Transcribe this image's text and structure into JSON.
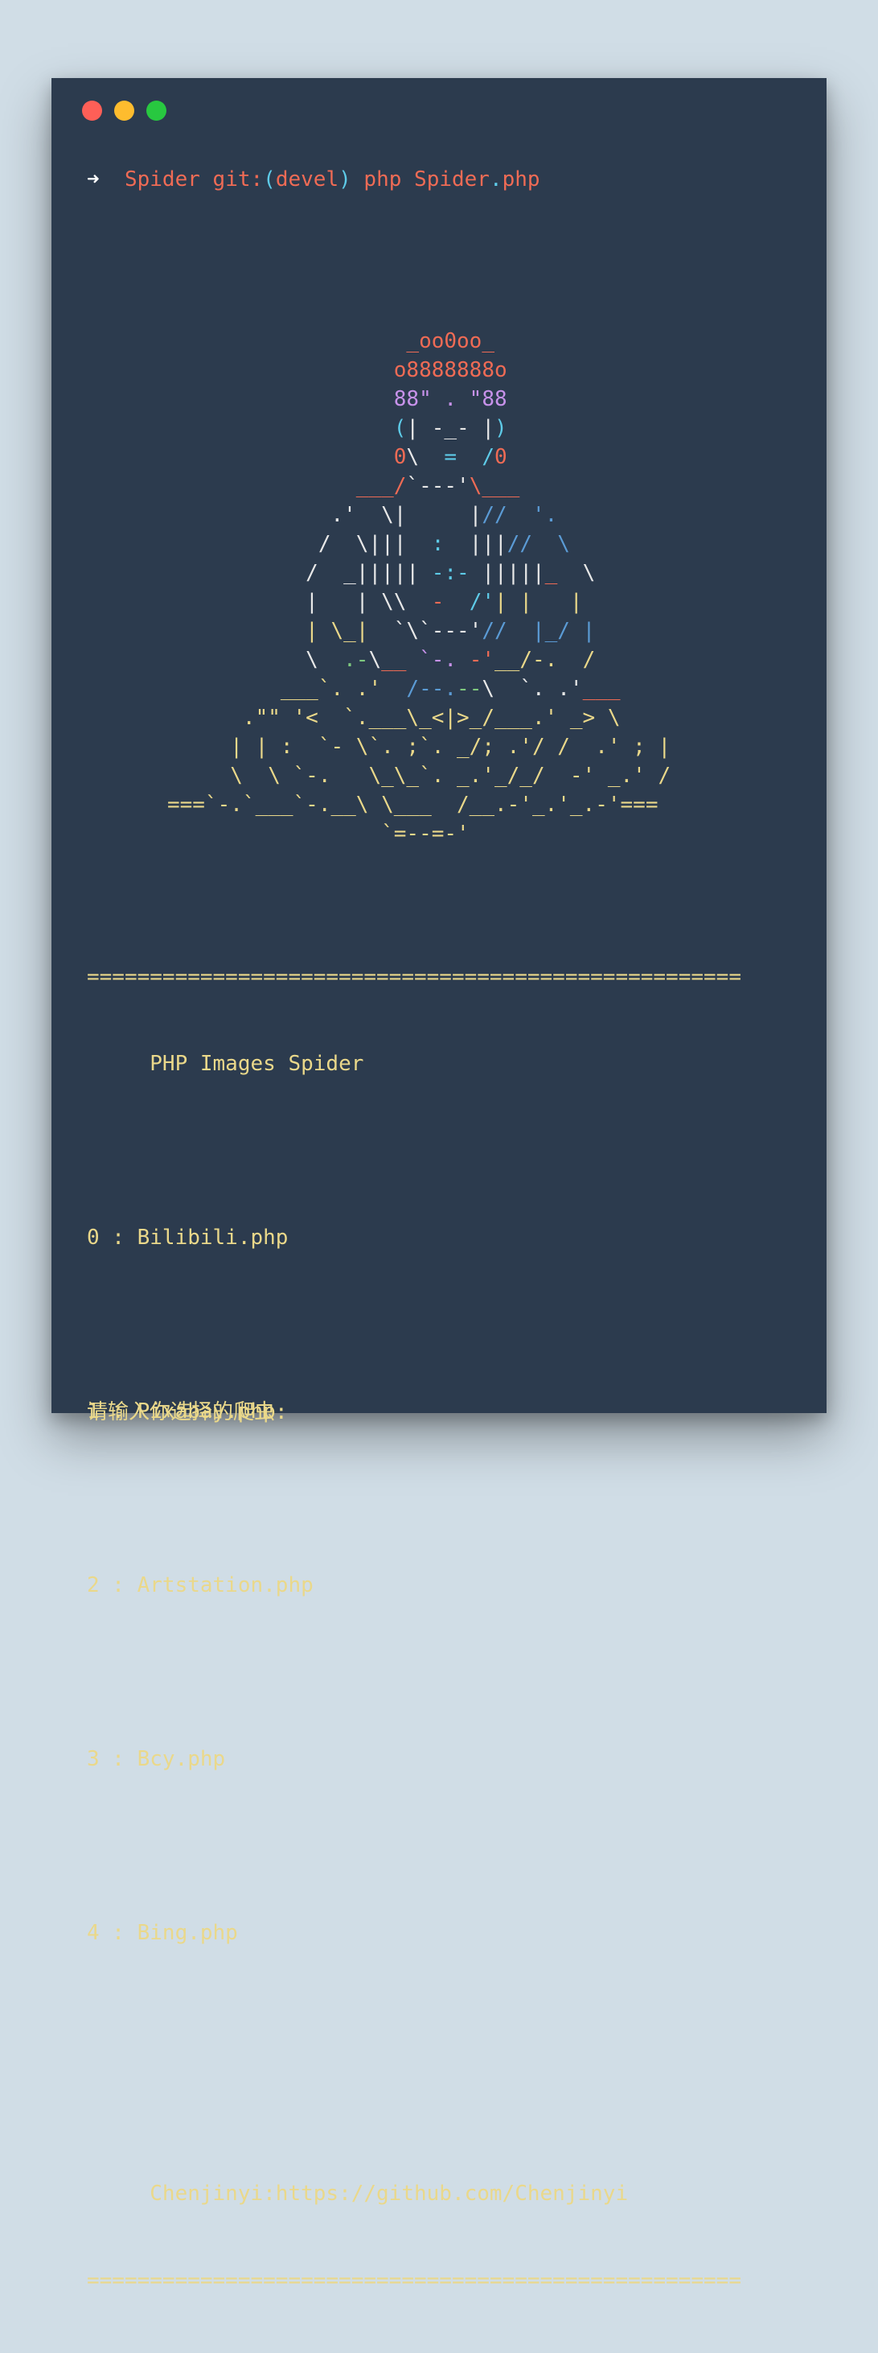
{
  "window": {
    "controls": [
      "close",
      "minimize",
      "maximize"
    ]
  },
  "prompt": {
    "arrow": "➜",
    "dir": "Spider",
    "git_prefix": "git:",
    "branch_open": "(",
    "branch": "devel",
    "branch_close": ")",
    "command": "php Spider",
    "dot": ".",
    "ext": "php"
  },
  "ascii_art": [
    [
      {
        "t": "                   _oo0oo_",
        "c": "r"
      }
    ],
    [
      {
        "t": "                  o8888888o",
        "c": "r"
      }
    ],
    [
      {
        "t": "                  88\" . \"88",
        "c": "p"
      }
    ],
    [
      {
        "t": "                  (",
        "c": "c"
      },
      {
        "t": "| -_- |",
        "c": "w"
      },
      {
        "t": ")",
        "c": "c"
      }
    ],
    [
      {
        "t": "                  0",
        "c": "r"
      },
      {
        "t": "\\  ",
        "c": "w"
      },
      {
        "t": "=",
        "c": "c"
      },
      {
        "t": "  /",
        "c": "c"
      },
      {
        "t": "0",
        "c": "r"
      }
    ],
    [
      {
        "t": "               ___/",
        "c": "r"
      },
      {
        "t": "`---'",
        "c": "w"
      },
      {
        "t": "\\___",
        "c": "r"
      }
    ],
    [
      {
        "t": "             .'  \\|     |",
        "c": "w"
      },
      {
        "t": "// ",
        "c": "b"
      },
      {
        "t": " '.",
        "c": "b"
      }
    ],
    [
      {
        "t": "            /  \\|||  ",
        "c": "w"
      },
      {
        "t": ":",
        "c": "c"
      },
      {
        "t": "  |||",
        "c": "w"
      },
      {
        "t": "//",
        "c": "b"
      },
      {
        "t": "  \\",
        "c": "b"
      }
    ],
    [
      {
        "t": "           /  _",
        "c": "w"
      },
      {
        "t": "|||||",
        "c": "w"
      },
      {
        "t": " -:- ",
        "c": "c"
      },
      {
        "t": "|||||",
        "c": "w"
      },
      {
        "t": "_  ",
        "c": "r"
      },
      {
        "t": "\\",
        "c": "w"
      }
    ],
    [
      {
        "t": "           |   | \\\\  ",
        "c": "w"
      },
      {
        "t": "-",
        "c": "r"
      },
      {
        "t": "  /'",
        "c": "c"
      },
      {
        "t": "| |   |",
        "c": "y"
      }
    ],
    [
      {
        "t": "           | \\_|  ",
        "c": "y"
      },
      {
        "t": "`\\`---'",
        "c": "w"
      },
      {
        "t": "//  |_/ |",
        "c": "b"
      }
    ],
    [
      {
        "t": "           \\  ",
        "c": "w"
      },
      {
        "t": ".-",
        "c": "g"
      },
      {
        "t": "\\",
        "c": "w"
      },
      {
        "t": "__ ",
        "c": "r"
      },
      {
        "t": "`-.",
        "c": "p"
      },
      {
        "t": " -'",
        "c": "r"
      },
      {
        "t": "__/-.  /",
        "c": "y"
      }
    ],
    [
      {
        "t": "         ___`. .'  ",
        "c": "y"
      },
      {
        "t": "/--.",
        "c": "b"
      },
      {
        "t": "--",
        "c": "g"
      },
      {
        "t": "\\  `. .'",
        "c": "w"
      },
      {
        "t": "___",
        "c": "r"
      }
    ],
    [
      {
        "t": "      .\"\" '<  `.___\\_<|>_/___.' _> \\",
        "c": "y"
      }
    ],
    [
      {
        "t": "     | | :  `- \\`. ;`. _/; .'/ /  .' ; |",
        "c": "y"
      }
    ],
    [
      {
        "t": "     \\  \\ `-.   \\_\\_`. _.'_/_/  -' _.' /",
        "c": "y"
      }
    ],
    [
      {
        "t": "===`-.`___`-.__\\ \\___  /__.-'_.'_.-'===",
        "c": "y"
      }
    ],
    [
      {
        "t": "                 `=--=-'",
        "c": "y"
      }
    ]
  ],
  "menu": {
    "separator": "====================================================",
    "title": "     PHP Images Spider",
    "options": [
      "0 : Bilibili.php",
      "1 : Pixabay.php",
      "2 : Artstation.php",
      "3 : Bcy.php",
      "4 : Bing.php"
    ],
    "footer": "     Chenjinyi:https://github.com/Chenjinyi"
  },
  "input_prompt": "请输入你选择的爬虫:",
  "colors": {
    "background": "#d0dde6",
    "terminal": "#2c3b4e",
    "red": "#ef6b55",
    "yellow": "#ead88a",
    "cyan": "#5ecbe8",
    "purple": "#c792ea",
    "blue": "#5b9bd5",
    "green": "#7fc97f"
  }
}
